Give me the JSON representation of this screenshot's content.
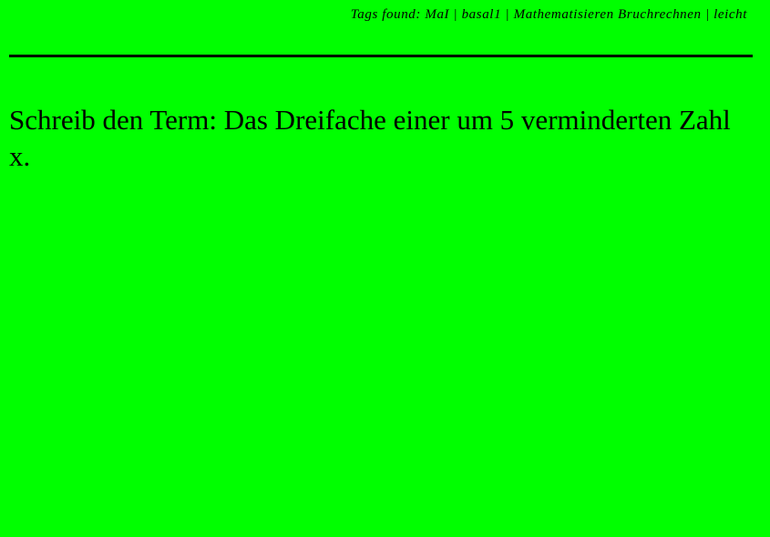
{
  "header": {
    "tags_line": "Tags found: MaI | basal1 | Mathematisieren Bruchrechnen | leicht"
  },
  "question": {
    "text": "Schreib den Term: Das Dreifache einer um 5 verminderten Zahl x."
  },
  "colors": {
    "background": "#00ff00",
    "text": "#000000"
  }
}
